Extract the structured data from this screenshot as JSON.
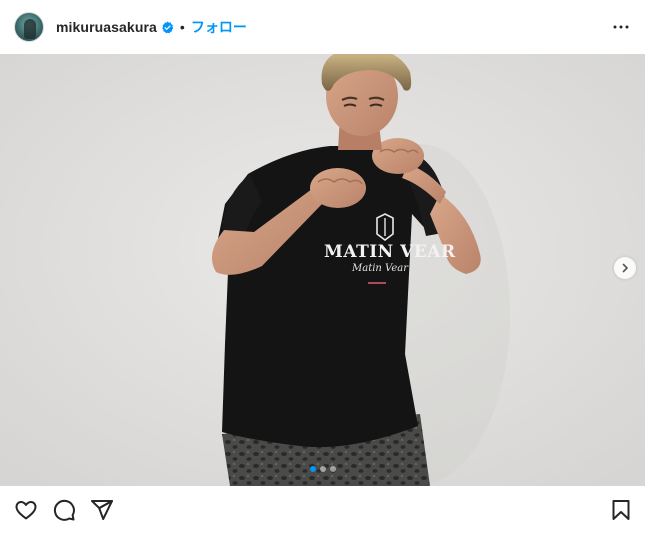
{
  "post": {
    "username": "mikuruasakura",
    "verified": true,
    "separator": "•",
    "follow_label": "フォロー",
    "avatar_icon": "profile-avatar",
    "more_icon": "more-options-icon"
  },
  "media": {
    "shirt_text_main": "MATIN VEAR",
    "shirt_text_script": "Matin Vear",
    "carousel": {
      "count": 3,
      "active_index": 0
    },
    "next_icon": "chevron-right-icon"
  },
  "actions": {
    "like_icon": "heart-icon",
    "comment_icon": "comment-icon",
    "share_icon": "share-icon",
    "save_icon": "bookmark-icon"
  },
  "colors": {
    "accent": "#0095f6",
    "text": "#262626",
    "background": "#ffffff"
  }
}
